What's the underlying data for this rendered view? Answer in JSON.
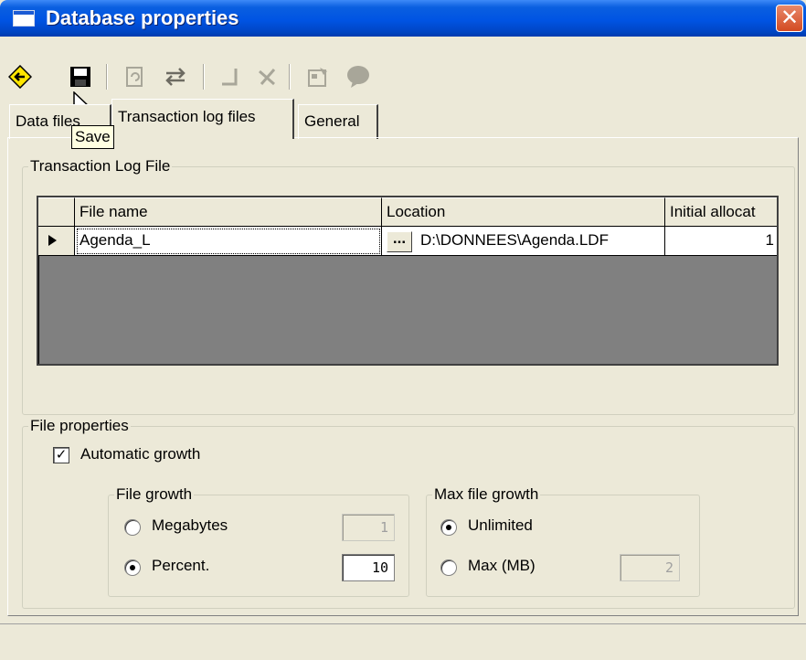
{
  "window": {
    "title": "Database properties",
    "close_glyph": "✕"
  },
  "toolbar": {
    "buttons": [
      {
        "name": "back-icon",
        "enabled": true
      },
      {
        "name": "save-icon",
        "enabled": true
      },
      {
        "name": "refresh-icon",
        "enabled": false
      },
      {
        "name": "swap-icon",
        "enabled": false
      },
      {
        "name": "insert-icon",
        "enabled": false
      },
      {
        "name": "delete-icon",
        "enabled": false
      },
      {
        "name": "properties-icon",
        "enabled": false
      },
      {
        "name": "help-icon",
        "enabled": false
      }
    ],
    "tooltip": "Save"
  },
  "tabs": [
    {
      "label": "Data files",
      "active": false
    },
    {
      "label": "Transaction log files",
      "active": true
    },
    {
      "label": "General",
      "active": false
    }
  ],
  "log_group": {
    "title": "Transaction Log File",
    "columns": [
      "File name",
      "Location",
      "Initial allocat"
    ],
    "rows": [
      {
        "file_name": "Agenda_L",
        "location": "D:\\DONNEES\\Agenda.LDF",
        "initial_allocation": "1",
        "browse_label": "..."
      }
    ]
  },
  "file_props": {
    "title": "File properties",
    "auto_growth": {
      "label": "Automatic growth",
      "checked": true
    },
    "file_growth": {
      "title": "File growth",
      "megabytes_label": "Megabytes",
      "megabytes_value": "1",
      "percent_label": "Percent.",
      "percent_value": "10",
      "selected": "percent"
    },
    "max_growth": {
      "title": "Max file growth",
      "unlimited_label": "Unlimited",
      "max_label": "Max (MB)",
      "max_value": "2",
      "selected": "unlimited"
    }
  },
  "colors": {
    "title_bar": "#0054e3",
    "window_bg": "#ece9d8",
    "grid_bg": "#808080",
    "tooltip_bg": "#ffffe1"
  }
}
